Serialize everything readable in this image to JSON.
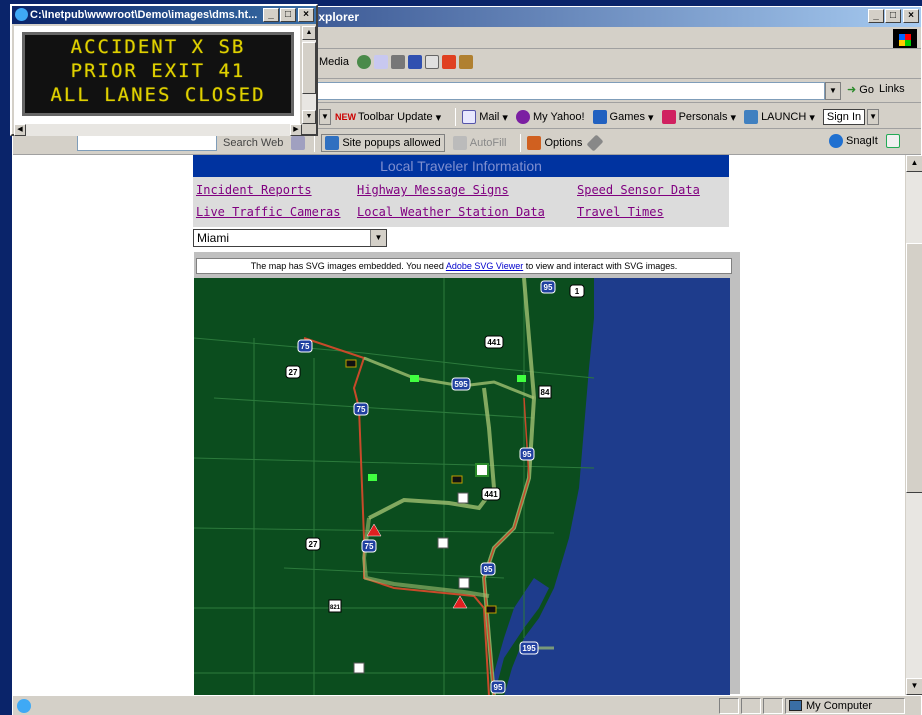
{
  "ie_window": {
    "title": ": Explorer",
    "menu_logo": "windows-logo-icon"
  },
  "toolbar_std": {
    "items": [
      "Media"
    ]
  },
  "address_bar": {
    "go_label": "Go",
    "links_label": "Links"
  },
  "yahoo_bar": {
    "toolbar_update": "Toolbar Update",
    "mail": "Mail",
    "my_yahoo": "My Yahoo!",
    "games": "Games",
    "personals": "Personals",
    "launch": "LAUNCH",
    "sign_in": "Sign In",
    "new_badge": "NEW"
  },
  "google_bar": {
    "search_web": "Search Web",
    "popups": "Site popups allowed",
    "autofill": "AutoFill",
    "options": "Options",
    "snagit": "SnagIt"
  },
  "page": {
    "header": "Local Traveler Information",
    "links": {
      "incident_reports": "Incident Reports",
      "highway_message_signs": "Highway Message Signs",
      "speed_sensor_data": "Speed Sensor Data",
      "live_traffic_cameras": "Live Traffic Cameras",
      "local_weather_station_data": "Local Weather Station Data",
      "travel_times": "Travel Times"
    },
    "city_selected": "Miami",
    "svg_note_before": "The map has SVG images embedded. You need ",
    "svg_note_link": "Adobe SVG Viewer",
    "svg_note_after": " to view and interact with SVG images."
  },
  "map": {
    "shields": {
      "i95_top": "95",
      "us1": "1",
      "s441_top": "441",
      "i75_top": "75",
      "s27_top": "27",
      "i595": "595",
      "s84": "84",
      "i75_mid": "75",
      "i95_mid": "95",
      "tpk": "",
      "s441_mid": "441",
      "s27_mid": "27",
      "i75_bot": "75",
      "i95_low": "95",
      "s821": "821",
      "i195": "195",
      "i95_bottom": "95"
    },
    "colors": {
      "land": "#0b4d1e",
      "water": "#1e3c8c",
      "road": "#2c7a3c",
      "highway_congested": "#c84a2a",
      "highway_normal": "#a0c070"
    }
  },
  "dms_popup": {
    "title": "C:\\Inetpub\\wwwroot\\Demo\\images\\dms.ht...",
    "lines": [
      "ACCIDENT X SB",
      "PRIOR EXIT 41",
      "ALL LANES CLOSED"
    ]
  },
  "status_bar": {
    "zone": "My Computer"
  }
}
